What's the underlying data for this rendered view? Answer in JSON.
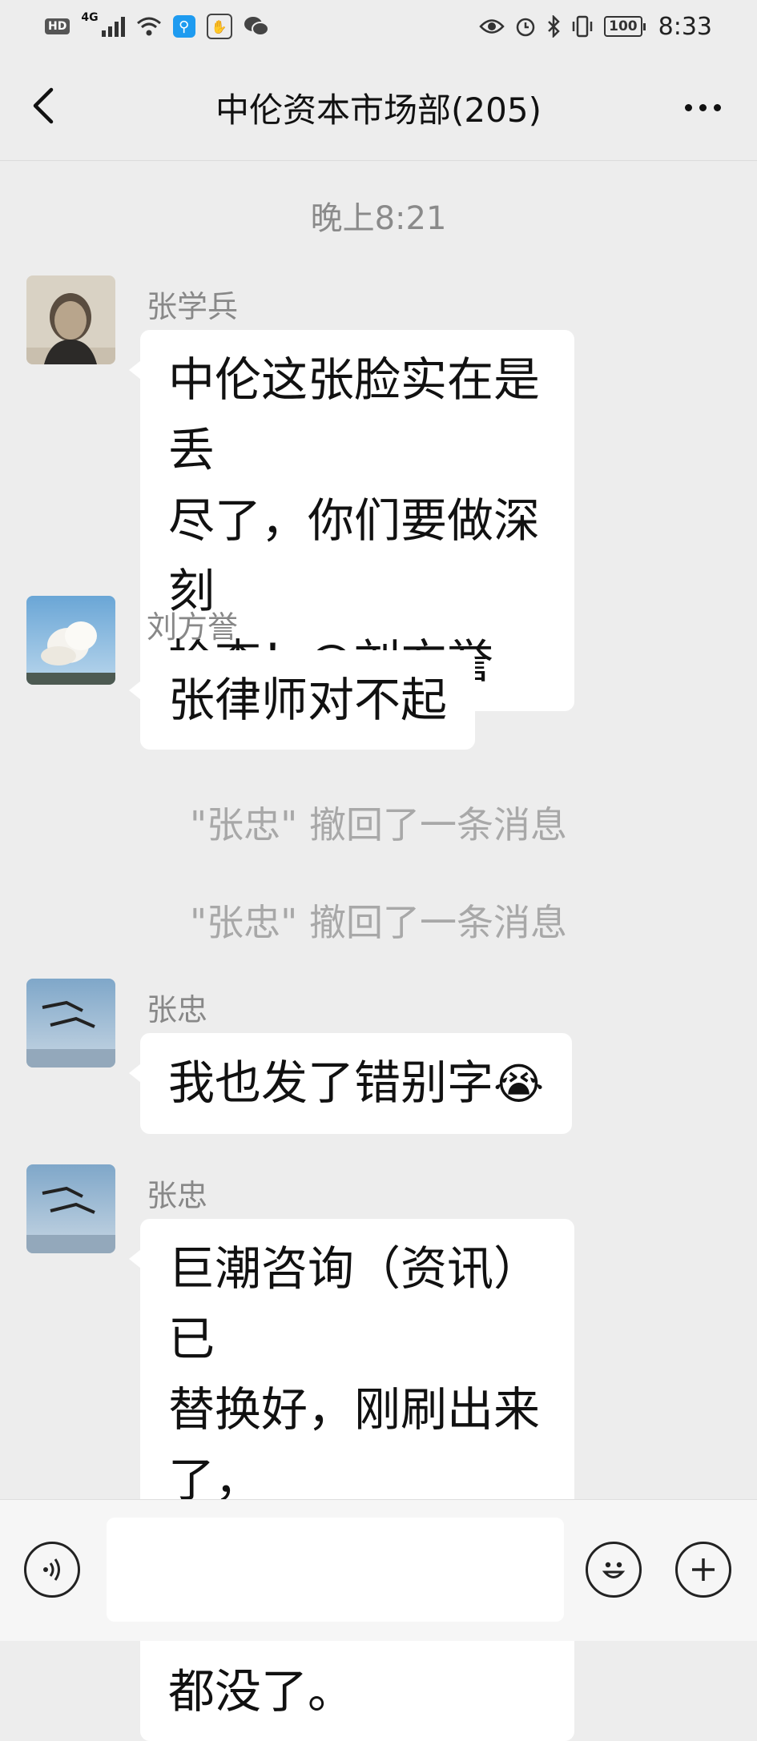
{
  "status_bar": {
    "hd": "HD",
    "network": "4G",
    "battery": "100",
    "time": "8:33"
  },
  "header": {
    "title": "中伦资本市场部(205)"
  },
  "chat": {
    "time_divider": "晚上8:21",
    "messages": [
      {
        "sender": "张学兵",
        "text": "中伦这张脸实在是丢\n尽了，你们要做深刻\n检查！@刘方誉"
      },
      {
        "sender": "刘方誉",
        "text": "张律师对不起"
      },
      {
        "system": "\"张忠\" 撤回了一条消息"
      },
      {
        "system": "\"张忠\" 撤回了一条消息"
      },
      {
        "sender": "张忠",
        "text": "我也发了错别字",
        "emoji": "😭"
      },
      {
        "sender": "张忠",
        "text": "巨潮咨询（资讯）已\n替换好，刚刷出来了，\n原链接点开已经什么\n都没了。"
      }
    ]
  },
  "input_bar": {
    "voice_icon": "voice-icon",
    "emoji_icon": "emoji-icon",
    "plus_icon": "plus-icon"
  }
}
